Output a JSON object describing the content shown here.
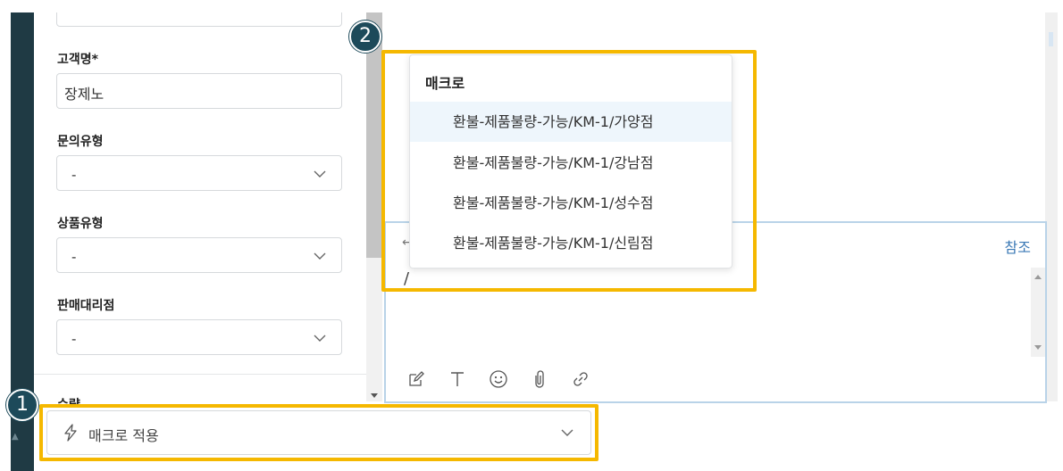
{
  "form": {
    "customer_name_label": "고객명*",
    "customer_name_value": "장제노",
    "inquiry_type_label": "문의유형",
    "inquiry_type_value": "-",
    "product_type_label": "상품유형",
    "product_type_value": "-",
    "dealer_label": "판매대리점",
    "dealer_value": "-",
    "next_section_label": "수량"
  },
  "macro_menu": {
    "header": "매크로",
    "items": [
      "환불-제품불량-가능/KM-1/가양점",
      "환불-제품불량-가능/KM-1/강남점",
      "환불-제품불량-가능/KM-1/성수점",
      "환불-제품불량-가능/KM-1/신림점"
    ]
  },
  "editor": {
    "reference_link": "참조",
    "back_arrow": "←",
    "content": "/"
  },
  "apply_bar": {
    "label": "매크로 적용"
  },
  "callouts": {
    "badge_1": "1",
    "badge_2": "2"
  },
  "colors": {
    "highlight": "#f5b800",
    "badge": "#1d4a5a",
    "rail": "#1f3a44",
    "link": "#3a78b5",
    "active_item": "#eef6fc"
  },
  "icons": {
    "editor_toolbar": [
      "edit-icon",
      "text-format-icon",
      "emoji-icon",
      "attachment-icon",
      "link-icon"
    ],
    "apply": "lightning-bolt-icon"
  }
}
